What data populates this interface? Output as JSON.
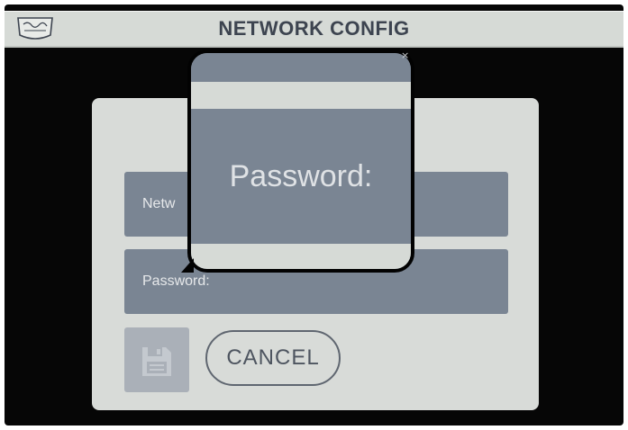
{
  "header": {
    "title": "NETWORK CONFIG",
    "logo_icon": "brand-logo-shield"
  },
  "form": {
    "network_label": "Netw",
    "password_label": "Password:",
    "save_icon": "floppy-disk-icon",
    "cancel_label": "CANCEL"
  },
  "magnifier": {
    "label": "Password:",
    "close_icon": "close-icon"
  },
  "colors": {
    "screen_bg": "#060606",
    "title_bar": "#d6dad6",
    "title_text": "#3d4450",
    "panel_bg": "#d8dbd8",
    "field_bg": "#7a8593",
    "field_text": "#e6e8ea",
    "save_button_bg": "#aab0b8",
    "cancel_border": "#5f6670"
  }
}
